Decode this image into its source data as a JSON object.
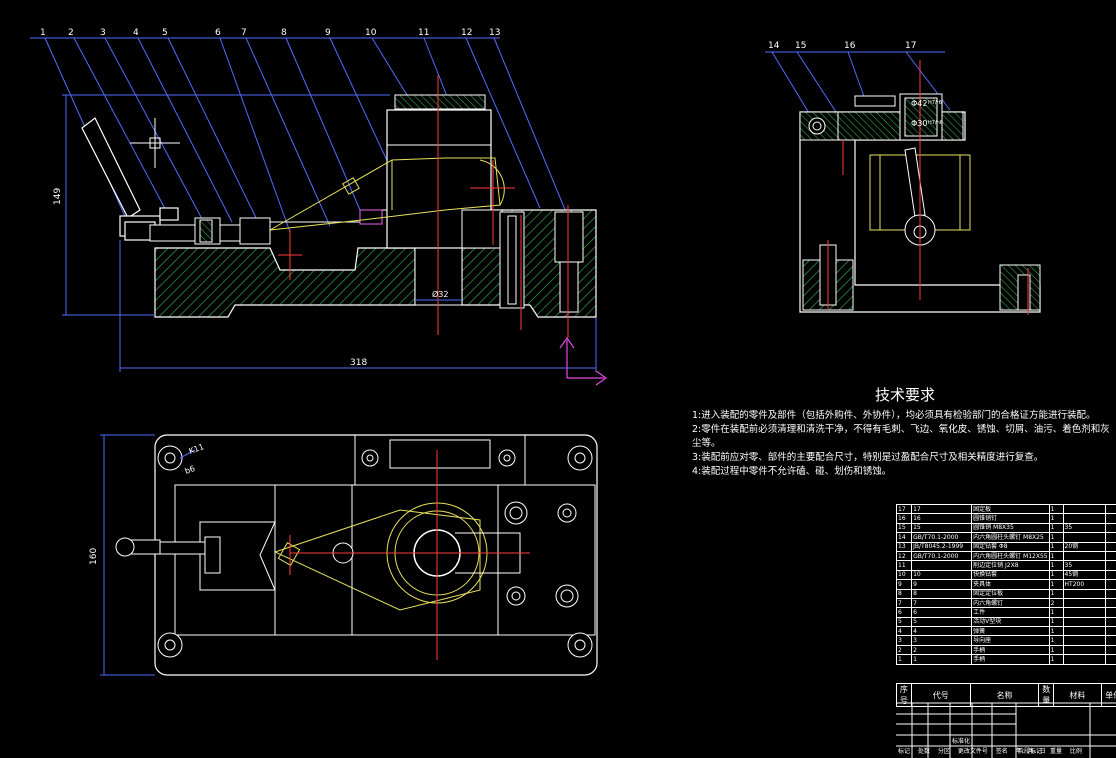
{
  "front_view": {
    "balloons": [
      "1",
      "2",
      "3",
      "4",
      "5",
      "6",
      "7",
      "8",
      "9",
      "10",
      "11",
      "12",
      "13"
    ],
    "dim_height": "149",
    "dim_width": "318",
    "dim_bore": "Ø32"
  },
  "side_view": {
    "balloons": [
      "14",
      "15",
      "16",
      "17"
    ],
    "fit_upper": "Φ42",
    "fit_upper_tol": "H7/r6",
    "fit_lower": "Φ30",
    "fit_lower_tol": "H7/n6"
  },
  "top_view": {
    "dim_height": "160",
    "fit_k": "K11",
    "fit_b": "b6"
  },
  "tech_requirements": {
    "title": "技术要求",
    "items": [
      "1:进入装配的零件及部件（包括外购件、外协件），均必须具有检验部门的合格证方能进行装配。",
      "2:零件在装配前必须清理和清洗干净，不得有毛刺、飞边、氧化皮、锈蚀、切屑、油污、着色剂和灰尘等。",
      "3:装配前应对零、部件的主要配合尺寸，特别是过盈配合尺寸及相关精度进行复查。",
      "4:装配过程中零件不允许磕、碰、划伤和锈蚀。"
    ]
  },
  "bom": {
    "rows": [
      [
        "17",
        "17",
        "固定板",
        "1",
        "",
        ""
      ],
      [
        "16",
        "16",
        "圆锥销钉",
        "1",
        "",
        ""
      ],
      [
        "15",
        "15",
        "圆锥销 M8X35",
        "1",
        "35",
        ""
      ],
      [
        "14",
        "GB/T70.1-2000",
        "内六角圆柱头螺钉 M8X25",
        "1",
        "",
        ""
      ],
      [
        "13",
        "JB/T8045.2-1999",
        "固定钻套 Φ8",
        "1",
        "20钢",
        ""
      ],
      [
        "12",
        "GB/T70.1-2000",
        "内六角圆柱头螺钉 M12X55",
        "1",
        "",
        ""
      ],
      [
        "11",
        "",
        "削边定位销 J2X8",
        "1",
        "35",
        ""
      ],
      [
        "10",
        "10",
        "快换钻套",
        "1",
        "45钢",
        ""
      ],
      [
        "9",
        "9",
        "夹具体",
        "1",
        "HT200",
        ""
      ],
      [
        "8",
        "8",
        "固定定位板",
        "1",
        "",
        ""
      ],
      [
        "7",
        "7",
        "内六角螺钉",
        "2",
        "",
        ""
      ],
      [
        "6",
        "6",
        "工件",
        "1",
        "",
        ""
      ],
      [
        "5",
        "5",
        "活动V型块",
        "1",
        "",
        ""
      ],
      [
        "4",
        "4",
        "弹簧",
        "1",
        "",
        ""
      ],
      [
        "3",
        "3",
        "导向座",
        "1",
        "",
        ""
      ],
      [
        "2",
        "2",
        "手柄",
        "1",
        "",
        ""
      ],
      [
        "1",
        "1",
        "手柄",
        "1",
        "",
        ""
      ]
    ],
    "header": [
      "序号",
      "代号",
      "名称",
      "数量",
      "材料",
      "单件"
    ],
    "footer_left": [
      "标记",
      "处数",
      "分区",
      "更改文件号",
      "签名",
      "年、月、日"
    ],
    "footer_left2": "标准化",
    "footer_right": [
      "阶段标记",
      "重量",
      "比例"
    ]
  }
}
